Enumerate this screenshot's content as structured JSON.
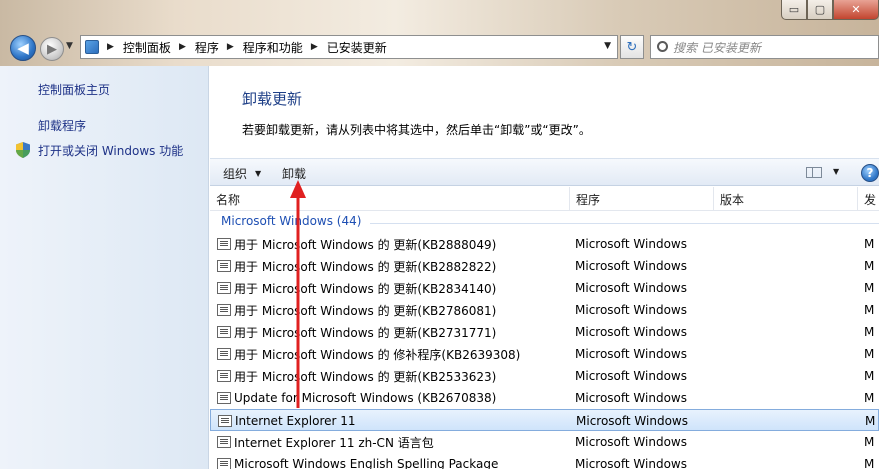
{
  "window": {
    "min_glyph": "▭",
    "max_glyph": "▢",
    "close_glyph": "✕"
  },
  "nav": {
    "back_glyph": "◀",
    "fwd_glyph": "▶",
    "breadcrumbs": [
      "控制面板",
      "程序",
      "程序和功能",
      "已安装更新"
    ],
    "refresh_glyph": "↻",
    "search_placeholder": "搜索 已安装更新"
  },
  "sidebar": {
    "home_link": "控制面板主页",
    "uninstall_link": "卸载程序",
    "features_link": "打开或关闭 Windows 功能"
  },
  "main": {
    "title": "卸载更新",
    "description": "若要卸载更新，请从列表中将其选中，然后单击“卸载”或“更改”。"
  },
  "toolbar": {
    "organize": "组织",
    "uninstall": "卸载",
    "help": "?"
  },
  "columns": {
    "name": "名称",
    "program": "程序",
    "version": "版本",
    "publisher": "发"
  },
  "group": {
    "label": "Microsoft Windows (44)"
  },
  "rows": [
    {
      "name": "用于 Microsoft Windows 的 更新(KB2888049)",
      "program": "Microsoft Windows",
      "pub": "M"
    },
    {
      "name": "用于 Microsoft Windows 的 更新(KB2882822)",
      "program": "Microsoft Windows",
      "pub": "M"
    },
    {
      "name": "用于 Microsoft Windows 的 更新(KB2834140)",
      "program": "Microsoft Windows",
      "pub": "M"
    },
    {
      "name": "用于 Microsoft Windows 的 更新(KB2786081)",
      "program": "Microsoft Windows",
      "pub": "M"
    },
    {
      "name": "用于 Microsoft Windows 的 更新(KB2731771)",
      "program": "Microsoft Windows",
      "pub": "M"
    },
    {
      "name": "用于 Microsoft Windows 的 修补程序(KB2639308)",
      "program": "Microsoft Windows",
      "pub": "M"
    },
    {
      "name": "用于 Microsoft Windows 的 更新(KB2533623)",
      "program": "Microsoft Windows",
      "pub": "M"
    },
    {
      "name": "Update for Microsoft Windows (KB2670838)",
      "program": "Microsoft Windows",
      "pub": "M"
    },
    {
      "name": "Internet Explorer 11",
      "program": "Microsoft Windows",
      "pub": "M",
      "selected": true
    },
    {
      "name": "Internet Explorer 11 zh-CN 语言包",
      "program": "Microsoft Windows",
      "pub": "M"
    },
    {
      "name": "Microsoft Windows English Spelling Package",
      "program": "Microsoft Windows",
      "pub": "M"
    }
  ],
  "colors": {
    "link": "#1e3287",
    "title": "#1e3f87",
    "group": "#1e4fb3",
    "annotation_arrow": "#e02020"
  }
}
